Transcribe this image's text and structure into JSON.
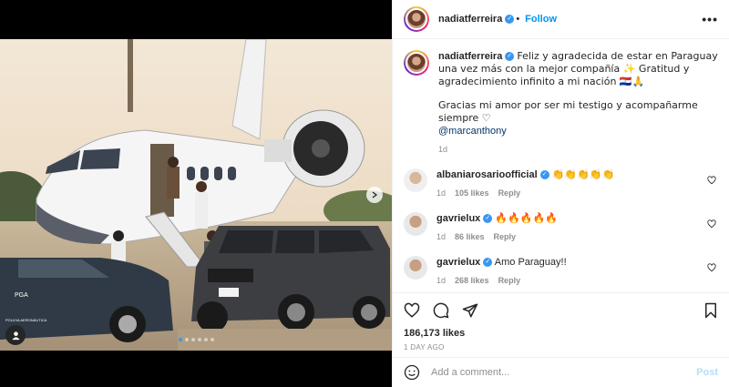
{
  "post": {
    "author": "nadiatferreira",
    "follow_label": "Follow",
    "more_label": "•••",
    "photo_badge": {
      "plate_text": "PGA",
      "caption_text": "POLICIA AERONÁUTICA"
    },
    "caption": {
      "username": "nadiatferreira",
      "line1": "Feliz y agradecida de estar en Paraguay una vez más con la mejor compañía ✨ Gratitud y agradecimiento infinito a mi nación 🇵🇾🙏",
      "line2": "Gracias mi amor por ser mi testigo y acompañarme siempre ♡",
      "mention": "@marcanthony",
      "time": "1d"
    },
    "comments": [
      {
        "username": "albaniarosarioofficial",
        "text": "👏👏👏👏👏",
        "time": "1d",
        "likes": "105 likes",
        "reply": "Reply"
      },
      {
        "username": "gavrielux",
        "text": "🔥🔥🔥🔥🔥",
        "time": "1d",
        "likes": "86 likes",
        "reply": "Reply"
      },
      {
        "username": "gavrielux",
        "text": "Amo Paraguay!!",
        "time": "1d",
        "likes": "268 likes",
        "reply": "Reply"
      }
    ],
    "likes": "186,173 likes",
    "date": "1 DAY AGO",
    "add_comment": {
      "placeholder": "Add a comment...",
      "post_label": "Post"
    }
  },
  "colors": {
    "accent": "#0095f6",
    "verified": "#3897f0",
    "muted": "#8e8e8e"
  }
}
